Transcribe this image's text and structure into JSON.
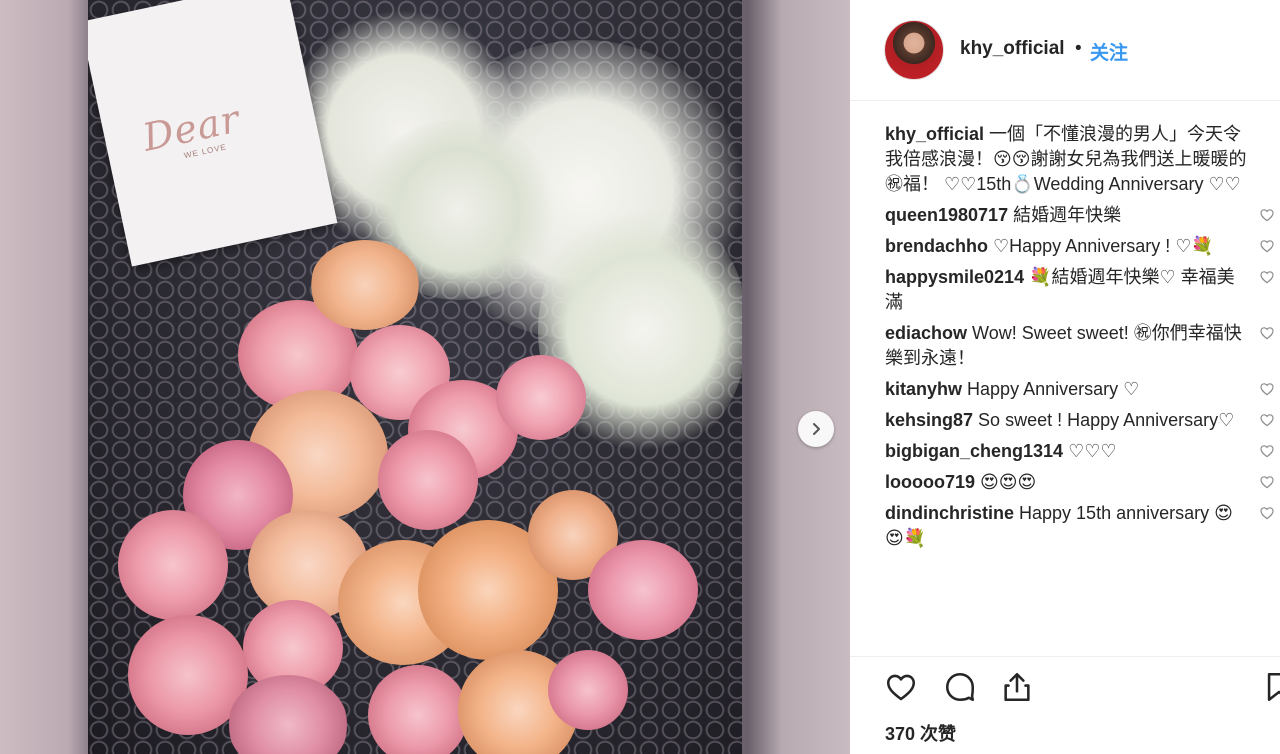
{
  "post": {
    "card_title": "Dear",
    "card_subtitle": "WE LOVE"
  },
  "header": {
    "username": "khy_official",
    "separator": "•",
    "follow_label": "关注"
  },
  "comments": [
    {
      "user": "khy_official",
      "text": " 一個「不懂浪漫的男人」今天令我倍感浪漫！😚😚謝謝女兒為我們送上暖暖的㊗福！ ♡♡15th💍Wedding Anniversary ♡♡",
      "like_icon": false
    },
    {
      "user": "queen1980717",
      "text": " 結婚週年快樂",
      "like_icon": true
    },
    {
      "user": "brendachho",
      "text": " ♡Happy Anniversary ! ♡💐",
      "like_icon": true
    },
    {
      "user": "happysmile0214",
      "text": " 💐結婚週年快樂♡ 幸福美滿",
      "like_icon": true
    },
    {
      "user": "ediachow",
      "text": " Wow! Sweet sweet! ㊗你們幸福快樂到永遠！",
      "like_icon": true
    },
    {
      "user": "kitanyhw",
      "text": " Happy Anniversary ♡",
      "like_icon": true
    },
    {
      "user": "kehsing87",
      "text": " So sweet ! Happy Anniversary♡",
      "like_icon": true
    },
    {
      "user": "bigbigan_cheng1314",
      "text": " ♡♡♡",
      "like_icon": true
    },
    {
      "user": "looooo719",
      "text": " 😍😍😍",
      "like_icon": true
    },
    {
      "user": "dindinchristine",
      "text": " Happy 15th anniversary 😍😍💐",
      "like_icon": true
    }
  ],
  "actions": {
    "like": "heart-icon",
    "comment": "comment-icon",
    "share": "share-icon",
    "save": "bookmark-icon"
  },
  "likes_text": "370 次赞",
  "colors": {
    "link": "#3897f0",
    "text": "#262626",
    "divider": "#efefef"
  }
}
